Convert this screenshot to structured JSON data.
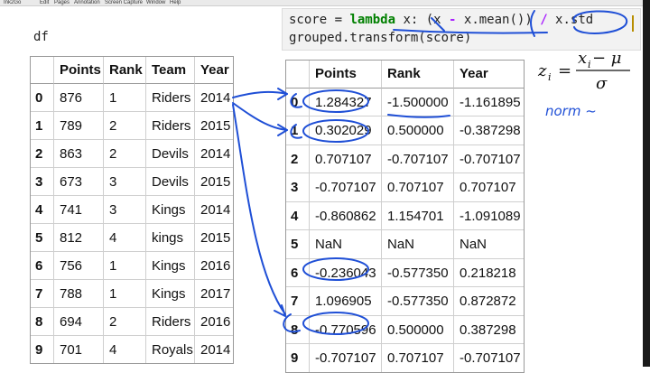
{
  "menubar": {
    "items": [
      "Ink2Go",
      "Edit",
      "Pages",
      "Annotation",
      "Screen Capture",
      "Window",
      "Help"
    ]
  },
  "left_cell": {
    "code": "df"
  },
  "right_cell": {
    "line1": {
      "a": "score = ",
      "kw": "lambda",
      "b": " x: (x ",
      "op1": "-",
      "c": " x.mean()) ",
      "op2": "/",
      "d": " x.std"
    },
    "line2": "grouped.transform(score)"
  },
  "df_table": {
    "columns": [
      "",
      "Points",
      "Rank",
      "Team",
      "Year"
    ],
    "rows": [
      [
        "0",
        "876",
        "1",
        "Riders",
        "2014"
      ],
      [
        "1",
        "789",
        "2",
        "Riders",
        "2015"
      ],
      [
        "2",
        "863",
        "2",
        "Devils",
        "2014"
      ],
      [
        "3",
        "673",
        "3",
        "Devils",
        "2015"
      ],
      [
        "4",
        "741",
        "3",
        "Kings",
        "2014"
      ],
      [
        "5",
        "812",
        "4",
        "kings",
        "2015"
      ],
      [
        "6",
        "756",
        "1",
        "Kings",
        "2016"
      ],
      [
        "7",
        "788",
        "1",
        "Kings",
        "2017"
      ],
      [
        "8",
        "694",
        "2",
        "Riders",
        "2016"
      ],
      [
        "9",
        "701",
        "4",
        "Royals",
        "2014"
      ]
    ]
  },
  "score_table": {
    "columns": [
      "",
      "Points",
      "Rank",
      "Year"
    ],
    "rows": [
      [
        "0",
        "1.284327",
        "-1.500000",
        "-1.161895"
      ],
      [
        "1",
        "0.302029",
        "0.500000",
        "-0.387298"
      ],
      [
        "2",
        "0.707107",
        "-0.707107",
        "-0.707107"
      ],
      [
        "3",
        "-0.707107",
        "0.707107",
        "0.707107"
      ],
      [
        "4",
        "-0.860862",
        "1.154701",
        "-1.091089"
      ],
      [
        "5",
        "NaN",
        "NaN",
        "NaN"
      ],
      [
        "6",
        "-0.236043",
        "-0.577350",
        "0.218218"
      ],
      [
        "7",
        "1.096905",
        "-0.577350",
        "0.872872"
      ],
      [
        "8",
        "-0.770596",
        "0.500000",
        "0.387298"
      ],
      [
        "9",
        "-0.707107",
        "0.707107",
        "-0.707107"
      ]
    ]
  },
  "formula": {
    "lhs_var": "z",
    "lhs_sub": "i",
    "eq": "=",
    "numerator": "x",
    "numerator_sub": "i",
    "numerator_rest": " − μ",
    "denominator": "σ"
  },
  "annotation": {
    "note": "norm ~",
    "ink_color": "#1f4fd6"
  }
}
